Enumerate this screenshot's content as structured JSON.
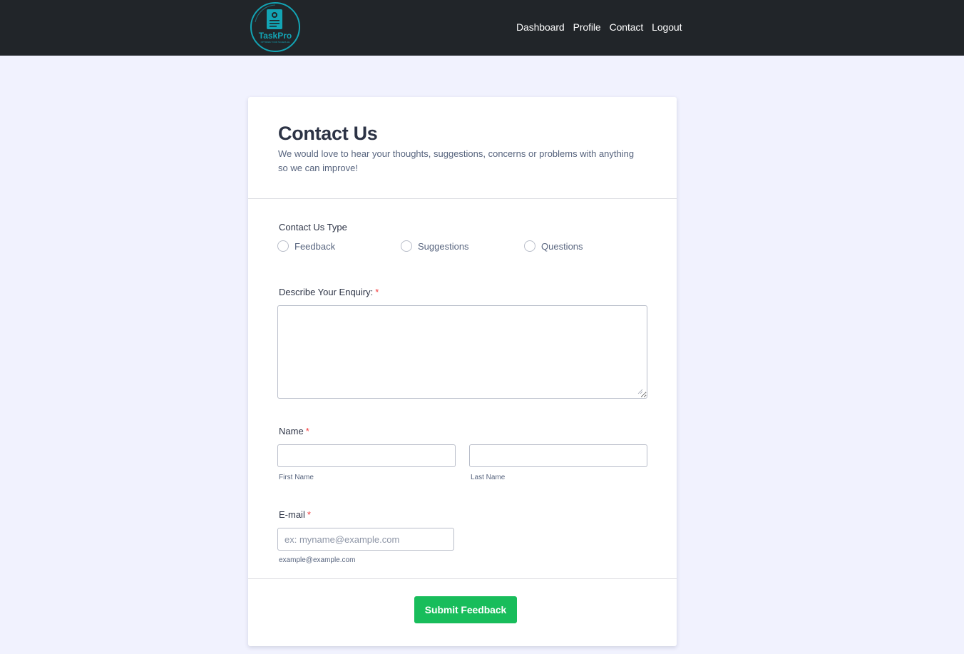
{
  "nav": {
    "logo_text": "TaskPro",
    "logo_tagline": "OPTIMIZE YOUR SCHEDULE",
    "links": [
      "Dashboard",
      "Profile",
      "Contact",
      "Logout"
    ]
  },
  "form": {
    "title": "Contact Us",
    "subtitle": "We would love to hear your thoughts, suggestions, concerns or problems with anything so we can improve!",
    "contact_type": {
      "label": "Contact Us Type",
      "options": [
        "Feedback",
        "Suggestions",
        "Questions"
      ]
    },
    "enquiry": {
      "label": "Describe Your Enquiry:",
      "required_mark": "*",
      "value": ""
    },
    "name": {
      "label": "Name",
      "required_mark": "*",
      "first_value": "",
      "last_value": "",
      "first_sublabel": "First Name",
      "last_sublabel": "Last Name"
    },
    "email": {
      "label": "E-mail",
      "required_mark": "*",
      "placeholder": "ex: myname@example.com",
      "value": "",
      "sublabel": "example@example.com"
    },
    "submit_label": "Submit Feedback"
  },
  "colors": {
    "navbar_bg": "#212529",
    "page_bg": "#f1f2fe",
    "brand_teal": "#13a4b4",
    "submit_green": "#18bd5b",
    "required_red": "#f23a3c",
    "title_text": "#2c3345"
  }
}
